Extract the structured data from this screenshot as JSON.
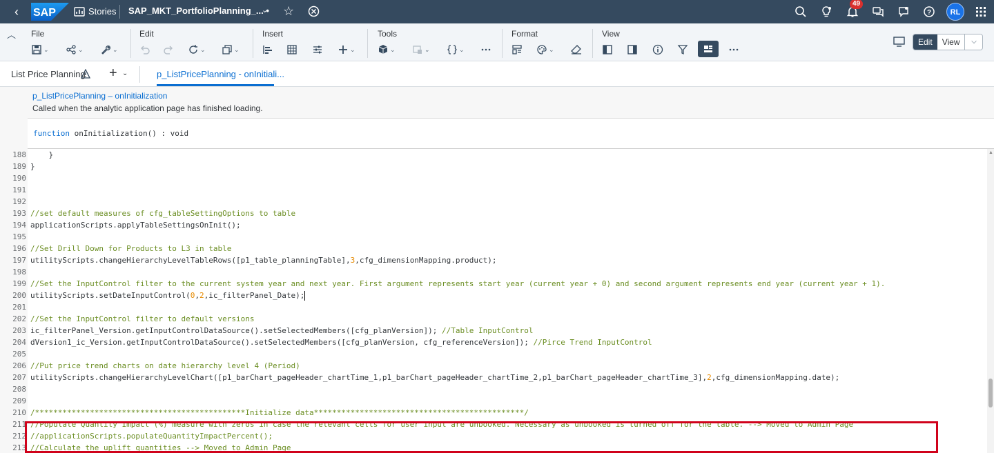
{
  "shell": {
    "logo_text": "SAP",
    "stories_label": "Stories",
    "doc_title": "SAP_MKT_PortfolioPlanning_... •",
    "notification_count": "49",
    "avatar_initials": "RL",
    "bg_color": "#354a5f"
  },
  "toolbar": {
    "groups": {
      "file": "File",
      "edit": "Edit",
      "insert": "Insert",
      "tools": "Tools",
      "format": "Format",
      "view": "View"
    },
    "mode_edit": "Edit",
    "mode_view": "View"
  },
  "tabs": {
    "page_tab": "List Price Planning",
    "script_tab": "p_ListPricePlanning - onInitiali..."
  },
  "script": {
    "title": "p_ListPricePlanning – onInitialization",
    "description": "Called when the analytic application page has finished loading.",
    "signature_keyword": "function",
    "signature_rest": " onInitialization() : void"
  },
  "code_lines": [
    {
      "n": "188",
      "t": "    }"
    },
    {
      "n": "189",
      "t": "}"
    },
    {
      "n": "190",
      "t": ""
    },
    {
      "n": "191",
      "t": ""
    },
    {
      "n": "192",
      "t": ""
    },
    {
      "n": "193",
      "c": "//set default measures of cfg_tableSettingOptions to table"
    },
    {
      "n": "194",
      "t": "applicationScripts.applyTableSettingsOnInit();"
    },
    {
      "n": "195",
      "t": ""
    },
    {
      "n": "196",
      "c": "//Set Drill Down for Products to L3 in table"
    },
    {
      "n": "197",
      "t": "utilityScripts.changeHierarchyLevelTableRows([p1_table_planningTable],",
      "num": "3",
      "t2": ",cfg_dimensionMapping.product);"
    },
    {
      "n": "198",
      "t": ""
    },
    {
      "n": "199",
      "c": "//Set the InputControl filter to the current system year and next year. First argument represents start year (current year + 0) and second argument represents end year (current year + 1)."
    },
    {
      "n": "200",
      "t": "utilityScripts.setDateInputControl(",
      "num": "0",
      "t2": ",",
      "num2": "2",
      "t3": ",ic_filterPanel_Date);",
      "cursor": true
    },
    {
      "n": "201",
      "t": ""
    },
    {
      "n": "202",
      "c": "//Set the InputControl filter to default versions"
    },
    {
      "n": "203",
      "t": "ic_filterPanel_Version.getInputControlDataSource().setSelectedMembers([cfg_planVersion]); ",
      "c2": "//Table InputControl"
    },
    {
      "n": "204",
      "t": "dVersion1_ic_Version.getInputControlDataSource().setSelectedMembers([cfg_planVersion, cfg_referenceVersion]); ",
      "c2": "//Pirce Trend InputControl"
    },
    {
      "n": "205",
      "t": ""
    },
    {
      "n": "206",
      "c": "//Put price trend charts on date hierarchy level 4 (Period)"
    },
    {
      "n": "207",
      "t": "utilityScripts.changeHierarchyLevelChart([p1_barChart_pageHeader_chartTime_1,p1_barChart_pageHeader_chartTime_2,p1_barChart_pageHeader_chartTime_3],",
      "num": "2",
      "t2": ",cfg_dimensionMapping.date);"
    },
    {
      "n": "208",
      "t": ""
    },
    {
      "n": "209",
      "t": ""
    },
    {
      "n": "210",
      "c": "/**********************************************Initialize data**********************************************/"
    },
    {
      "n": "211",
      "c": "//Populate Quantity Impact (%) measure with zeros in case the relevant cells for user input are unbooked. Necessary as unbooked is turned off for the table. --> Moved to Admin Page"
    },
    {
      "n": "212",
      "c": "//applicationScripts.populateQuantityImpactPercent();"
    },
    {
      "n": "213",
      "c": "//Calculate the uplift quantities --> Moved to Admin Page"
    }
  ],
  "colors": {
    "comment": "#6b8e23",
    "number": "#e68a00",
    "keyword": "#0a6ed1",
    "highlight_box": "#d0021b"
  }
}
